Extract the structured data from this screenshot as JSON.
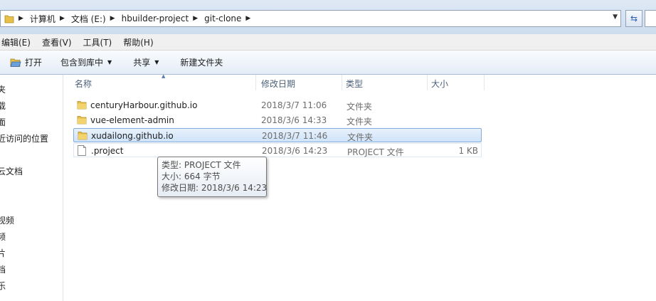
{
  "breadcrumbs": [
    {
      "label": "计算机"
    },
    {
      "label": "文档 (E:)"
    },
    {
      "label": "hbuilder-project"
    },
    {
      "label": "git-clone"
    }
  ],
  "menu": [
    {
      "label": "编辑(E)"
    },
    {
      "label": "查看(V)"
    },
    {
      "label": "工具(T)"
    },
    {
      "label": "帮助(H)"
    }
  ],
  "toolbar": {
    "open_label": "打开",
    "include_label": "包含到库中",
    "share_label": "共享",
    "new_folder_label": "新建文件夹"
  },
  "nav_items": [
    {
      "label": "夹"
    },
    {
      "label": "载"
    },
    {
      "label": "面"
    },
    {
      "label": "近访问的位置"
    },
    {
      "label": "云文档"
    },
    {
      "label": "视频"
    },
    {
      "label": "频"
    },
    {
      "label": "片"
    },
    {
      "label": "档"
    },
    {
      "label": "乐"
    }
  ],
  "columns": {
    "name": "名称",
    "date": "修改日期",
    "type": "类型",
    "size": "大小"
  },
  "files": [
    {
      "name": "centuryHarbour.github.io",
      "date": "2018/3/7 11:06",
      "type": "文件夹",
      "size": "",
      "icon": "folder-icon",
      "selected": false
    },
    {
      "name": "vue-element-admin",
      "date": "2018/3/6 14:33",
      "type": "文件夹",
      "size": "",
      "icon": "folder-icon",
      "selected": false
    },
    {
      "name": "xudailong.github.io",
      "date": "2018/3/7 11:46",
      "type": "文件夹",
      "size": "",
      "icon": "folder-icon",
      "selected": true
    },
    {
      "name": ".project",
      "date": "2018/3/6 14:23",
      "type": "PROJECT 文件",
      "size": "1 KB",
      "icon": "file-icon",
      "selected": false
    }
  ],
  "tooltip": {
    "type_line": "类型: PROJECT 文件",
    "size_line": "大小: 664 字节",
    "date_line": "修改日期: 2018/3/6 14:23"
  },
  "colors": {
    "selection_border": "#84acdd",
    "folder_yellow": "#e8c04a"
  }
}
